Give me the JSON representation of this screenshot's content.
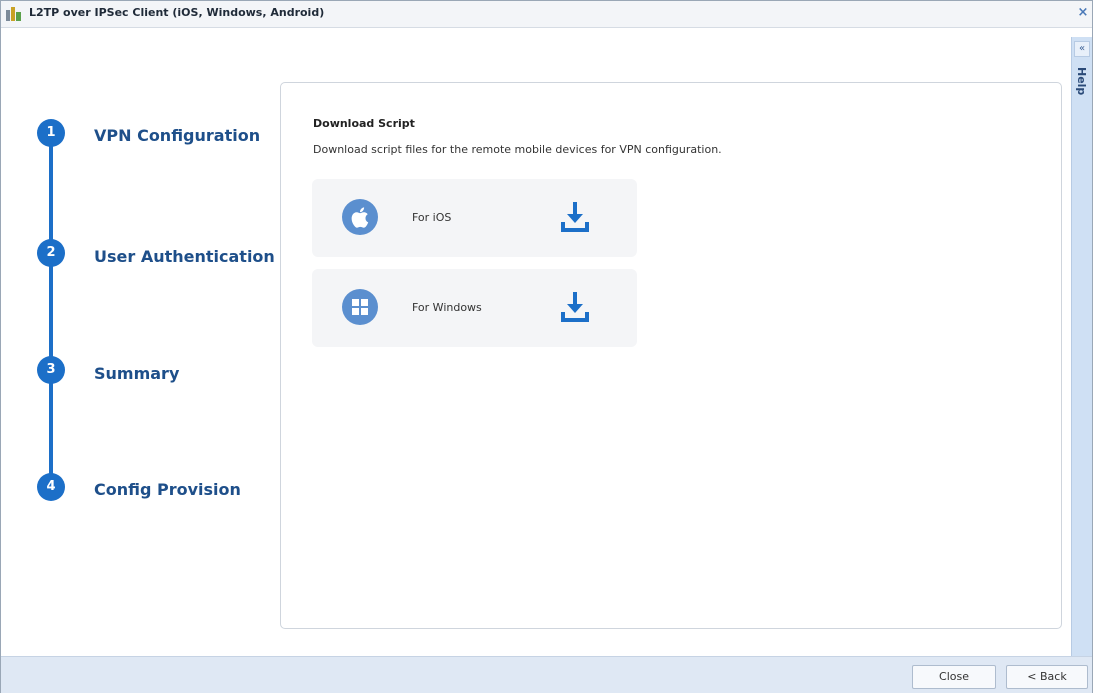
{
  "window": {
    "title": "L2TP over IPSec Client (iOS, Windows, Android)",
    "close_glyph": "×",
    "help_collapse_glyph": "«",
    "help_label": "Help"
  },
  "steps": [
    {
      "number": "1",
      "label": "VPN Configuration"
    },
    {
      "number": "2",
      "label": "User Authentication"
    },
    {
      "number": "3",
      "label": "Summary"
    },
    {
      "number": "4",
      "label": "Config Provision"
    }
  ],
  "main": {
    "section_title": "Download Script",
    "section_desc": "Download script files for the remote mobile devices for VPN configuration.",
    "downloads": [
      {
        "label": "For iOS",
        "os_icon": "apple-icon",
        "action_icon": "download-icon"
      },
      {
        "label": "For Windows",
        "os_icon": "windows-icon",
        "action_icon": "download-icon"
      }
    ]
  },
  "footer": {
    "close_label": "Close",
    "back_label": "< Back"
  },
  "colors": {
    "accent": "#1c6fc8",
    "step_label": "#1e4f8a",
    "help_strip": "#cfe0f4",
    "footer": "#dfe8f4"
  }
}
